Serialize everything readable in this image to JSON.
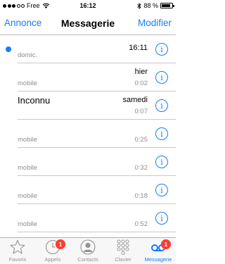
{
  "status_bar": {
    "carrier": "Free",
    "time": "16:12",
    "battery": "88 %",
    "battery_level": 0.88
  },
  "nav": {
    "left_button": "Annonce",
    "title": "Messagerie",
    "right_button": "Modifier"
  },
  "voicemails": [
    {
      "caller": "",
      "label": "domic.",
      "date": "16:11",
      "duration": "",
      "unread": true
    },
    {
      "caller": "",
      "label": "mobile",
      "date": "hier",
      "duration": "0:02",
      "unread": false
    },
    {
      "caller": "Inconnu",
      "label": "",
      "date": "samedi",
      "duration": "0:07",
      "unread": false
    },
    {
      "caller": "",
      "label": "mobile",
      "date": "",
      "duration": "0:25",
      "unread": false
    },
    {
      "caller": "",
      "label": "mobile",
      "date": "",
      "duration": "0:32",
      "unread": false
    },
    {
      "caller": "",
      "label": "mobile",
      "date": "",
      "duration": "0:18",
      "unread": false
    },
    {
      "caller": "",
      "label": "mobile",
      "date": "",
      "duration": "0:52",
      "unread": false
    }
  ],
  "tabs": [
    {
      "label": "Favoris",
      "icon": "star-icon",
      "badge": ""
    },
    {
      "label": "Appels",
      "icon": "clock-icon",
      "badge": "1"
    },
    {
      "label": "Contacts",
      "icon": "contacts-icon",
      "badge": ""
    },
    {
      "label": "Clavier",
      "icon": "keypad-icon",
      "badge": ""
    },
    {
      "label": "Messagerie",
      "icon": "voicemail-icon",
      "badge": "1",
      "active": true
    }
  ],
  "colors": {
    "accent": "#157efb",
    "badge": "#ff3b30",
    "secondary_text": "#8e8e93",
    "tab_inactive": "#929292"
  }
}
